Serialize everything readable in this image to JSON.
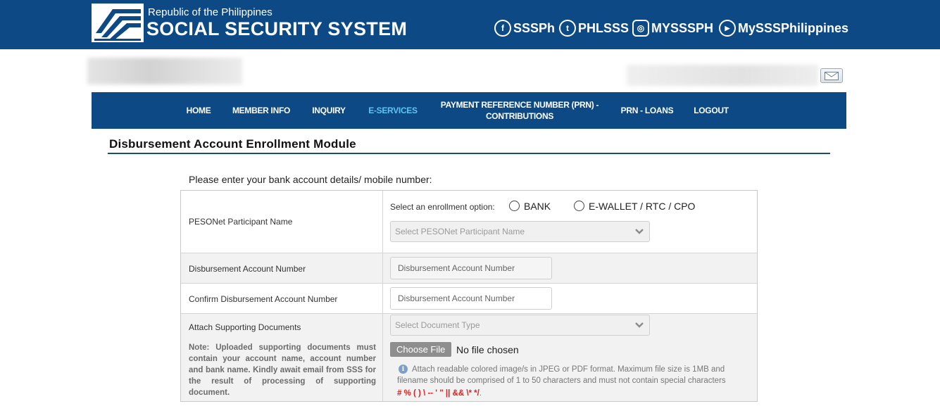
{
  "header": {
    "republic": "Republic of the Philippines",
    "title": "SOCIAL SECURITY SYSTEM",
    "social": [
      {
        "icon": "facebook-icon",
        "glyph": "f",
        "label": "SSSPh"
      },
      {
        "icon": "twitter-icon",
        "glyph": "t",
        "label": "PHLSSS"
      },
      {
        "icon": "instagram-icon",
        "glyph": "◎",
        "label": "MYSSSPH"
      },
      {
        "icon": "youtube-icon",
        "glyph": "▶",
        "label": "MySSSPhilippines"
      }
    ]
  },
  "nav": {
    "items": [
      {
        "label": "HOME"
      },
      {
        "label": "MEMBER INFO"
      },
      {
        "label": "INQUIRY"
      },
      {
        "label": "E-SERVICES",
        "active": true
      },
      {
        "label": "PAYMENT REFERENCE NUMBER (PRN) - CONTRIBUTIONS"
      },
      {
        "label": "PRN - LOANS"
      },
      {
        "label": "LOGOUT"
      }
    ]
  },
  "page": {
    "module_title": "Disbursement Account Enrollment Module",
    "prompt": "Please enter your bank account details/ mobile number:"
  },
  "form": {
    "pesonet": {
      "label": "PESONet Participant Name",
      "option_prompt": "Select an enrollment option:",
      "option_bank": "BANK",
      "option_ewallet": "E-WALLET / RTC / CPO",
      "select_placeholder": "Select PESONet Participant Name"
    },
    "account": {
      "label": "Disbursement Account Number",
      "placeholder": "Disbursement Account Number"
    },
    "confirm": {
      "label": "Confirm Disbursement Account Number",
      "placeholder": "Disbursement Account Number"
    },
    "attach": {
      "label": "Attach Supporting Documents",
      "note": "Note: Uploaded supporting documents must contain your account name, account number and bank name. Kindly await email from SSS for the result of processing of supporting document.",
      "doc_type_placeholder": "Select Document Type",
      "choose_file": "Choose File",
      "no_file": "No file chosen",
      "info_line1": "Attach readable colored image/s in JPEG or PDF format. Maximum file size is 1MB and",
      "info_line2": "filename should be comprised of 1 to 50 characters and must not contain special characters",
      "special_chars": "# % ( ) \\ -- ' \" || && \\* */",
      "info_end": "."
    }
  },
  "colors": {
    "brand_blue": "#0d4a85",
    "nav_active": "#5ec4ef",
    "warning_red": "#e01e1e"
  }
}
